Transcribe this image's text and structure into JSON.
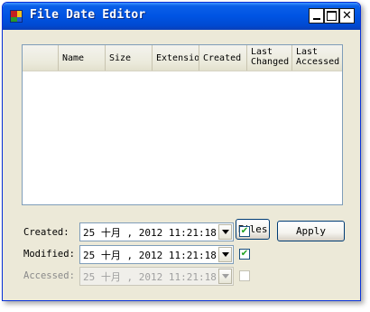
{
  "window": {
    "title": "File Date Editor",
    "icon": "app-grid-icon"
  },
  "caption_buttons": {
    "minimize_icon": "minimize-icon",
    "maximize_icon": "maximize-icon",
    "close_glyph": "✕"
  },
  "file_list": {
    "columns": [
      "",
      "Name",
      "Size",
      "Extension",
      "Created",
      "Last\nChanged",
      "Last\nAccessed"
    ],
    "rows": []
  },
  "fields": {
    "created": {
      "label": "Created:",
      "value": "25  十月 , 2012 11:21:18",
      "checked": true,
      "check_glyph": "✔",
      "enabled": true
    },
    "modified": {
      "label": "Modified:",
      "value": "25  十月 , 2012 11:21:18",
      "checked": true,
      "check_glyph": "✔",
      "enabled": true
    },
    "accessed": {
      "label": "Accessed:",
      "value": "25  十月 , 2012 11:21:18",
      "checked": false,
      "check_glyph": "",
      "enabled": false
    }
  },
  "buttons": {
    "files_label": "Files",
    "apply_label": "Apply"
  }
}
